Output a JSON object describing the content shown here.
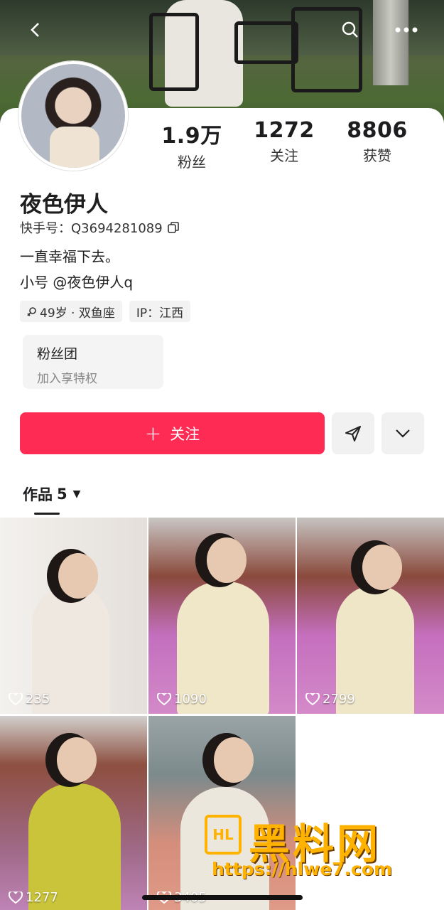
{
  "header": {
    "back_icon": "chevron-left-icon",
    "search_icon": "search-icon",
    "more_icon": "more-dots-icon"
  },
  "profile": {
    "stats": [
      {
        "value": "1.9万",
        "label": "粉丝"
      },
      {
        "value": "1272",
        "label": "关注"
      },
      {
        "value": "8806",
        "label": "获赞"
      }
    ],
    "name": "夜色伊人",
    "id_label": "快手号：Q3694281089",
    "bio_lines": [
      "一直幸福下去。",
      "小号 @夜色伊人q"
    ],
    "tags": [
      "49岁 · 双鱼座",
      "IP：江西"
    ],
    "fan_club": {
      "title": "粉丝团",
      "subtitle": "加入享特权"
    }
  },
  "actions": {
    "follow_label": "关注",
    "share_icon": "send-icon",
    "more_icon": "chevron-down-icon"
  },
  "works_tab": {
    "label": "作品",
    "count": "5"
  },
  "works": [
    {
      "likes": "235"
    },
    {
      "likes": "1090"
    },
    {
      "likes": "2799"
    },
    {
      "likes": "1277"
    },
    {
      "likes": "3405"
    }
  ],
  "watermark": {
    "title": "黑料网",
    "url": "https://hlwe7.com"
  },
  "colors": {
    "accent": "#fe2c55"
  }
}
